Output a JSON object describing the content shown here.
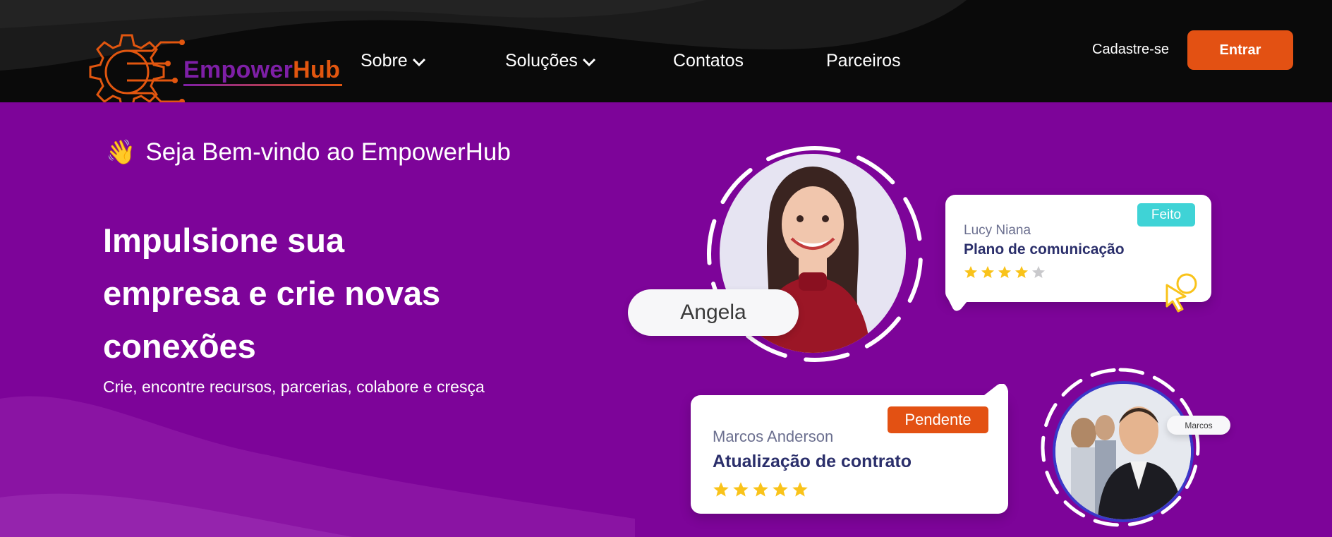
{
  "header": {
    "logo": {
      "part1": "Empower",
      "part2": "Hub"
    },
    "nav": [
      {
        "label": "Sobre",
        "has_dropdown": true
      },
      {
        "label": "Soluções",
        "has_dropdown": true
      },
      {
        "label": "Contatos",
        "has_dropdown": false
      },
      {
        "label": "Parceiros",
        "has_dropdown": false
      }
    ],
    "signup_label": "Cadastre-se",
    "login_label": "Entrar"
  },
  "hero": {
    "welcome_emoji": "👋",
    "welcome": "Seja Bem-vindo ao EmpowerHub",
    "headline_lines": [
      "Impulsione sua",
      "empresa e crie novas",
      "conexões"
    ],
    "subline": "Crie, encontre recursos, parcerias, colabore e cresça"
  },
  "illustration": {
    "angela": {
      "name": "Angela"
    },
    "marcos_avatar": {
      "name": "Marcos"
    },
    "card_lucy": {
      "person": "Lucy Niana",
      "task": "Plano de comunicação",
      "status": "Feito",
      "rating": 4,
      "max_rating": 5
    },
    "card_marcos": {
      "person": "Marcos Anderson",
      "task": "Atualização de contrato",
      "status": "Pendente",
      "rating": 5,
      "max_rating": 5
    }
  },
  "colors": {
    "brand_purple": "#7d0499",
    "accent_orange": "#e35113",
    "header_bg": "#0a0a0a",
    "badge_done": "#3fd3d6",
    "badge_pending": "#e35113",
    "star_on": "#f9c31a",
    "star_off": "#c9c9cc"
  }
}
